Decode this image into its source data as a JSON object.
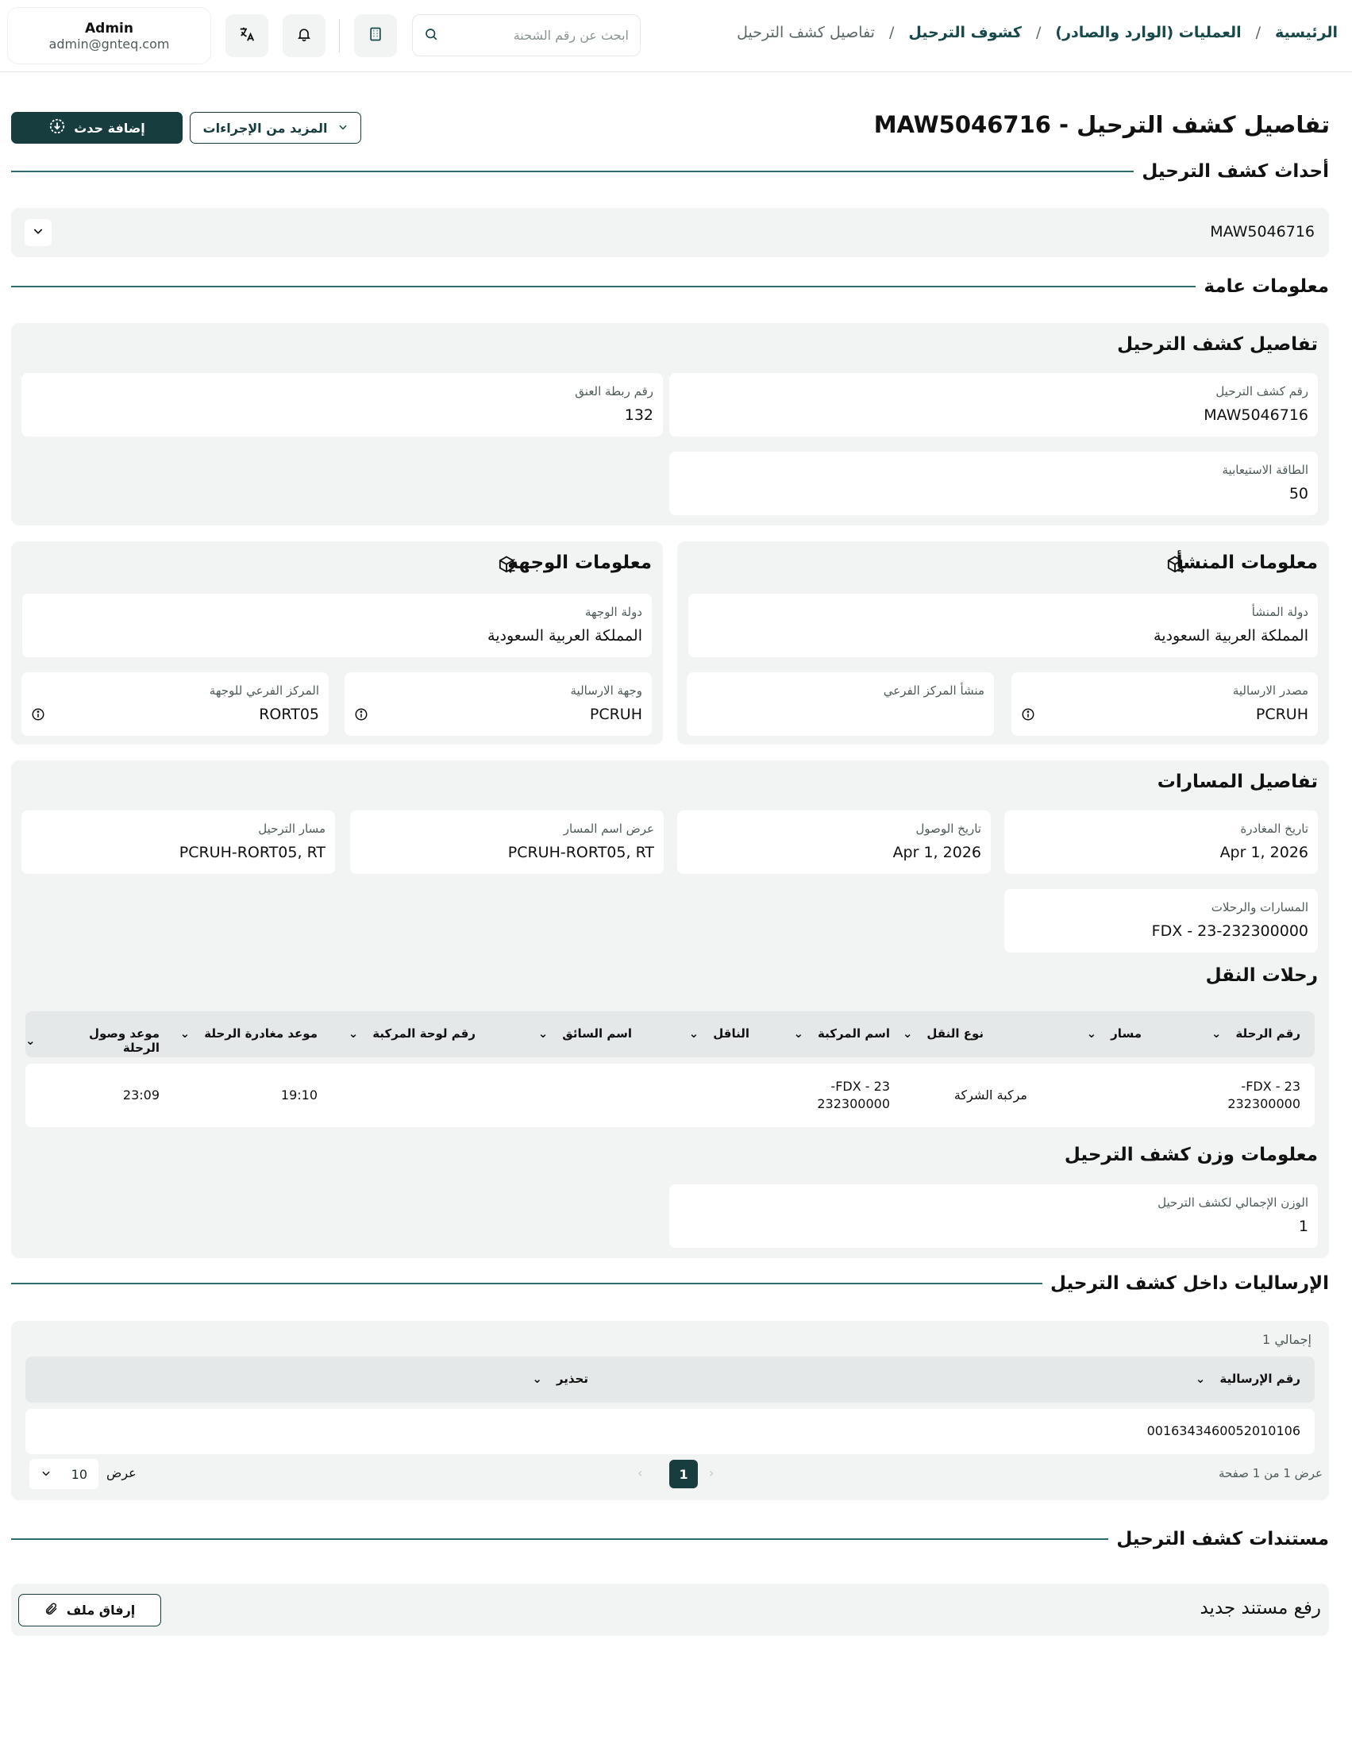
{
  "breadcrumb": {
    "home": "الرئيسية",
    "operations": "العمليات (الوارد والصادر)",
    "manifests": "كشوف الترحيل",
    "current": "تفاصيل كشف الترحيل",
    "separator": "/"
  },
  "search": {
    "placeholder": "ابحث عن رقم الشحنة"
  },
  "user": {
    "name": "Admin",
    "email": "admin@gnteq.com"
  },
  "page": {
    "title": "تفاصيل كشف الترحيل - MAW5046716",
    "add_event_label": "إضافة حدث",
    "more_actions_label": "المزيد من الإجراءات"
  },
  "sections": {
    "events": "أحداث كشف الترحيل",
    "general": "معلومات عامة",
    "shipments": "الإرساليات داخل كشف الترحيل",
    "documents": "مستندات كشف الترحيل"
  },
  "events": {
    "accordion_label": "MAW5046716"
  },
  "manifest_details": {
    "title": "تفاصيل كشف الترحيل",
    "manifest_number_label": "رقم كشف الترحيل",
    "manifest_number": "MAW5046716",
    "neck_tag_label": "رقم ربطة العنق",
    "neck_tag": "132",
    "capacity_label": "الطاقة الاستيعابية",
    "capacity": "50"
  },
  "origin": {
    "title": "معلومات المنشأ",
    "country_label": "دولة المنشأ",
    "country": "المملكة العربية السعودية",
    "source_label": "مصدر الارسالية",
    "source": "PCRUH",
    "sub_hub_label": "منشأ المركز الفرعي",
    "sub_hub": ""
  },
  "destination": {
    "title": "معلومات الوجهة",
    "country_label": "دولة الوجهة",
    "country": "المملكة العربية السعودية",
    "dest_label": "وجهة الارسالية",
    "dest": "PCRUH",
    "sub_hub_label": "المركز الفرعي للوجهة",
    "sub_hub": "RORT05"
  },
  "routes": {
    "title": "تفاصيل المسارات",
    "departure_label": "تاريخ المغادرة",
    "departure": "Apr 1, 2026",
    "arrival_label": "تاريخ الوصول",
    "arrival": "Apr 1, 2026",
    "route_name_label": "عرض اسم المسار",
    "route_name": "PCRUH-RORT05, RT",
    "manifest_route_label": "مسار الترحيل",
    "manifest_route": "PCRUH-RORT05, RT",
    "paths_label": "المسارات والرحلات",
    "paths": "FDX - 23-232300000"
  },
  "trips": {
    "title": "رحلات النقل",
    "columns": [
      "رقم الرحلة",
      "مسار",
      "نوع النقل",
      "اسم المركبة",
      "الناقل",
      "اسم السائق",
      "رقم لوحة المركبة",
      "موعد مغادرة الرحلة",
      "موعد وصول الرحلة"
    ],
    "row": {
      "trip_no_line1": "FDX - 23-",
      "trip_no_line2": "232300000",
      "transport_type": "مركبة الشركة",
      "vehicle_line1": "FDX - 23-",
      "vehicle_line2": "232300000",
      "departure_time": "19:10",
      "arrival_time": "23:09"
    }
  },
  "weight": {
    "title": "معلومات وزن كشف الترحيل",
    "total_label": "الوزن الإجمالي لكشف الترحيل",
    "total": "1"
  },
  "shipments": {
    "total_label": "إجمالي 1",
    "col_number": "رقم الإرسالية",
    "col_warning": "تحذير",
    "row_number": "0016343460052010106",
    "pager_info": "عرض 1 من 1 صفحة",
    "current_page": "1",
    "show_label": "عرض",
    "page_size": "10"
  },
  "documents": {
    "upload_label": "رفع مستند جديد",
    "attach_label": "إرفاق ملف"
  }
}
